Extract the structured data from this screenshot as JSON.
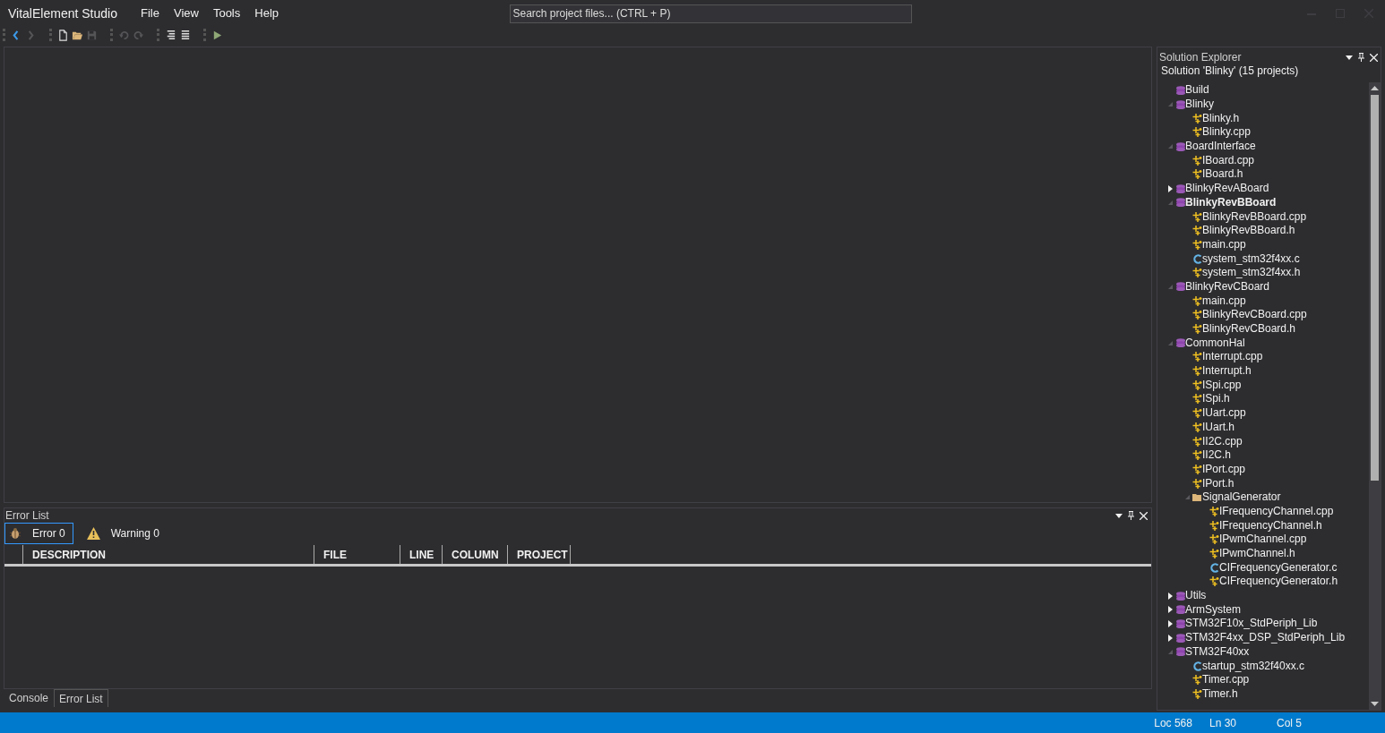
{
  "window": {
    "title": "VitalElement Studio"
  },
  "menu": [
    "File",
    "View",
    "Tools",
    "Help"
  ],
  "search": {
    "placeholder": "Search project files... (CTRL + P)"
  },
  "toolbar": [
    [
      {
        "kind": "back",
        "disabled": false
      },
      {
        "kind": "forward",
        "disabled": true
      }
    ],
    [
      {
        "kind": "new",
        "disabled": false
      },
      {
        "kind": "open",
        "disabled": false
      },
      {
        "kind": "save",
        "disabled": true
      }
    ],
    [
      {
        "kind": "undo",
        "disabled": true
      },
      {
        "kind": "redo",
        "disabled": true
      }
    ],
    [
      {
        "kind": "comment",
        "disabled": false
      },
      {
        "kind": "uncomment",
        "disabled": false
      }
    ],
    [
      {
        "kind": "run",
        "disabled": false
      }
    ]
  ],
  "error_list": {
    "title": "Error List",
    "filters": [
      {
        "kind": "error",
        "label": "Error 0",
        "selected": true
      },
      {
        "kind": "warning",
        "label": "Warning 0",
        "selected": false
      }
    ],
    "columns": [
      "DESCRIPTION",
      "FILE",
      "LINE",
      "COLUMN",
      "PROJECT"
    ]
  },
  "bottom_tabs": [
    {
      "label": "Console",
      "selected": false
    },
    {
      "label": "Error List",
      "selected": true
    }
  ],
  "solution_explorer": {
    "title": "Solution Explorer",
    "solution": "Solution 'Blinky' (15 projects)",
    "items": [
      {
        "kind": "project",
        "name": "Build",
        "active": false
      },
      {
        "kind": "project",
        "name": "Blinky",
        "active": false,
        "expanded": true,
        "children": [
          {
            "kind": "source",
            "name": "Blinky.h"
          },
          {
            "kind": "source",
            "name": "Blinky.cpp"
          }
        ]
      },
      {
        "kind": "project",
        "name": "BoardInterface",
        "active": false,
        "expanded": true,
        "children": [
          {
            "kind": "source",
            "name": "IBoard.cpp"
          },
          {
            "kind": "source",
            "name": "IBoard.h"
          }
        ]
      },
      {
        "kind": "project",
        "name": "BlinkyRevABoard",
        "active": false,
        "expanded": false
      },
      {
        "kind": "project",
        "name": "BlinkyRevBBoard",
        "active": true,
        "expanded": true,
        "children": [
          {
            "kind": "source",
            "name": "BlinkyRevBBoard.cpp"
          },
          {
            "kind": "source",
            "name": "BlinkyRevBBoard.h"
          },
          {
            "kind": "source",
            "name": "main.cpp"
          },
          {
            "kind": "c",
            "name": "system_stm32f4xx.c"
          },
          {
            "kind": "source",
            "name": "system_stm32f4xx.h"
          }
        ]
      },
      {
        "kind": "project",
        "name": "BlinkyRevCBoard",
        "active": false,
        "expanded": true,
        "children": [
          {
            "kind": "source",
            "name": "main.cpp"
          },
          {
            "kind": "source",
            "name": "BlinkyRevCBoard.cpp"
          },
          {
            "kind": "source",
            "name": "BlinkyRevCBoard.h"
          }
        ]
      },
      {
        "kind": "project",
        "name": "CommonHal",
        "active": false,
        "expanded": true,
        "children": [
          {
            "kind": "source",
            "name": "Interrupt.cpp"
          },
          {
            "kind": "source",
            "name": "Interrupt.h"
          },
          {
            "kind": "source",
            "name": "ISpi.cpp"
          },
          {
            "kind": "source",
            "name": "ISpi.h"
          },
          {
            "kind": "source",
            "name": "IUart.cpp"
          },
          {
            "kind": "source",
            "name": "IUart.h"
          },
          {
            "kind": "source",
            "name": "II2C.cpp"
          },
          {
            "kind": "source",
            "name": "II2C.h"
          },
          {
            "kind": "source",
            "name": "IPort.cpp"
          },
          {
            "kind": "source",
            "name": "IPort.h"
          },
          {
            "kind": "folder",
            "name": "SignalGenerator",
            "expanded": true,
            "children": [
              {
                "kind": "source",
                "name": "IFrequencyChannel.cpp"
              },
              {
                "kind": "source",
                "name": "IFrequencyChannel.h"
              },
              {
                "kind": "source",
                "name": "IPwmChannel.cpp"
              },
              {
                "kind": "source",
                "name": "IPwmChannel.h"
              },
              {
                "kind": "c",
                "name": "CIFrequencyGenerator.c"
              },
              {
                "kind": "source",
                "name": "CIFrequencyGenerator.h"
              }
            ]
          }
        ]
      },
      {
        "kind": "project",
        "name": "Utils",
        "active": false,
        "expanded": false
      },
      {
        "kind": "project",
        "name": "ArmSystem",
        "active": false,
        "expanded": false
      },
      {
        "kind": "project",
        "name": "STM32F10x_StdPeriph_Lib",
        "active": false,
        "expanded": false
      },
      {
        "kind": "project",
        "name": "STM32F4xx_DSP_StdPeriph_Lib",
        "active": false,
        "expanded": false
      },
      {
        "kind": "project",
        "name": "STM32F40xx",
        "active": false,
        "expanded": true,
        "children": [
          {
            "kind": "c",
            "name": "startup_stm32f40xx.c"
          },
          {
            "kind": "source",
            "name": "Timer.cpp"
          },
          {
            "kind": "source",
            "name": "Timer.h"
          }
        ]
      }
    ]
  },
  "status_bar": [
    "Loc 568",
    "Ln 30",
    "Col 5"
  ]
}
